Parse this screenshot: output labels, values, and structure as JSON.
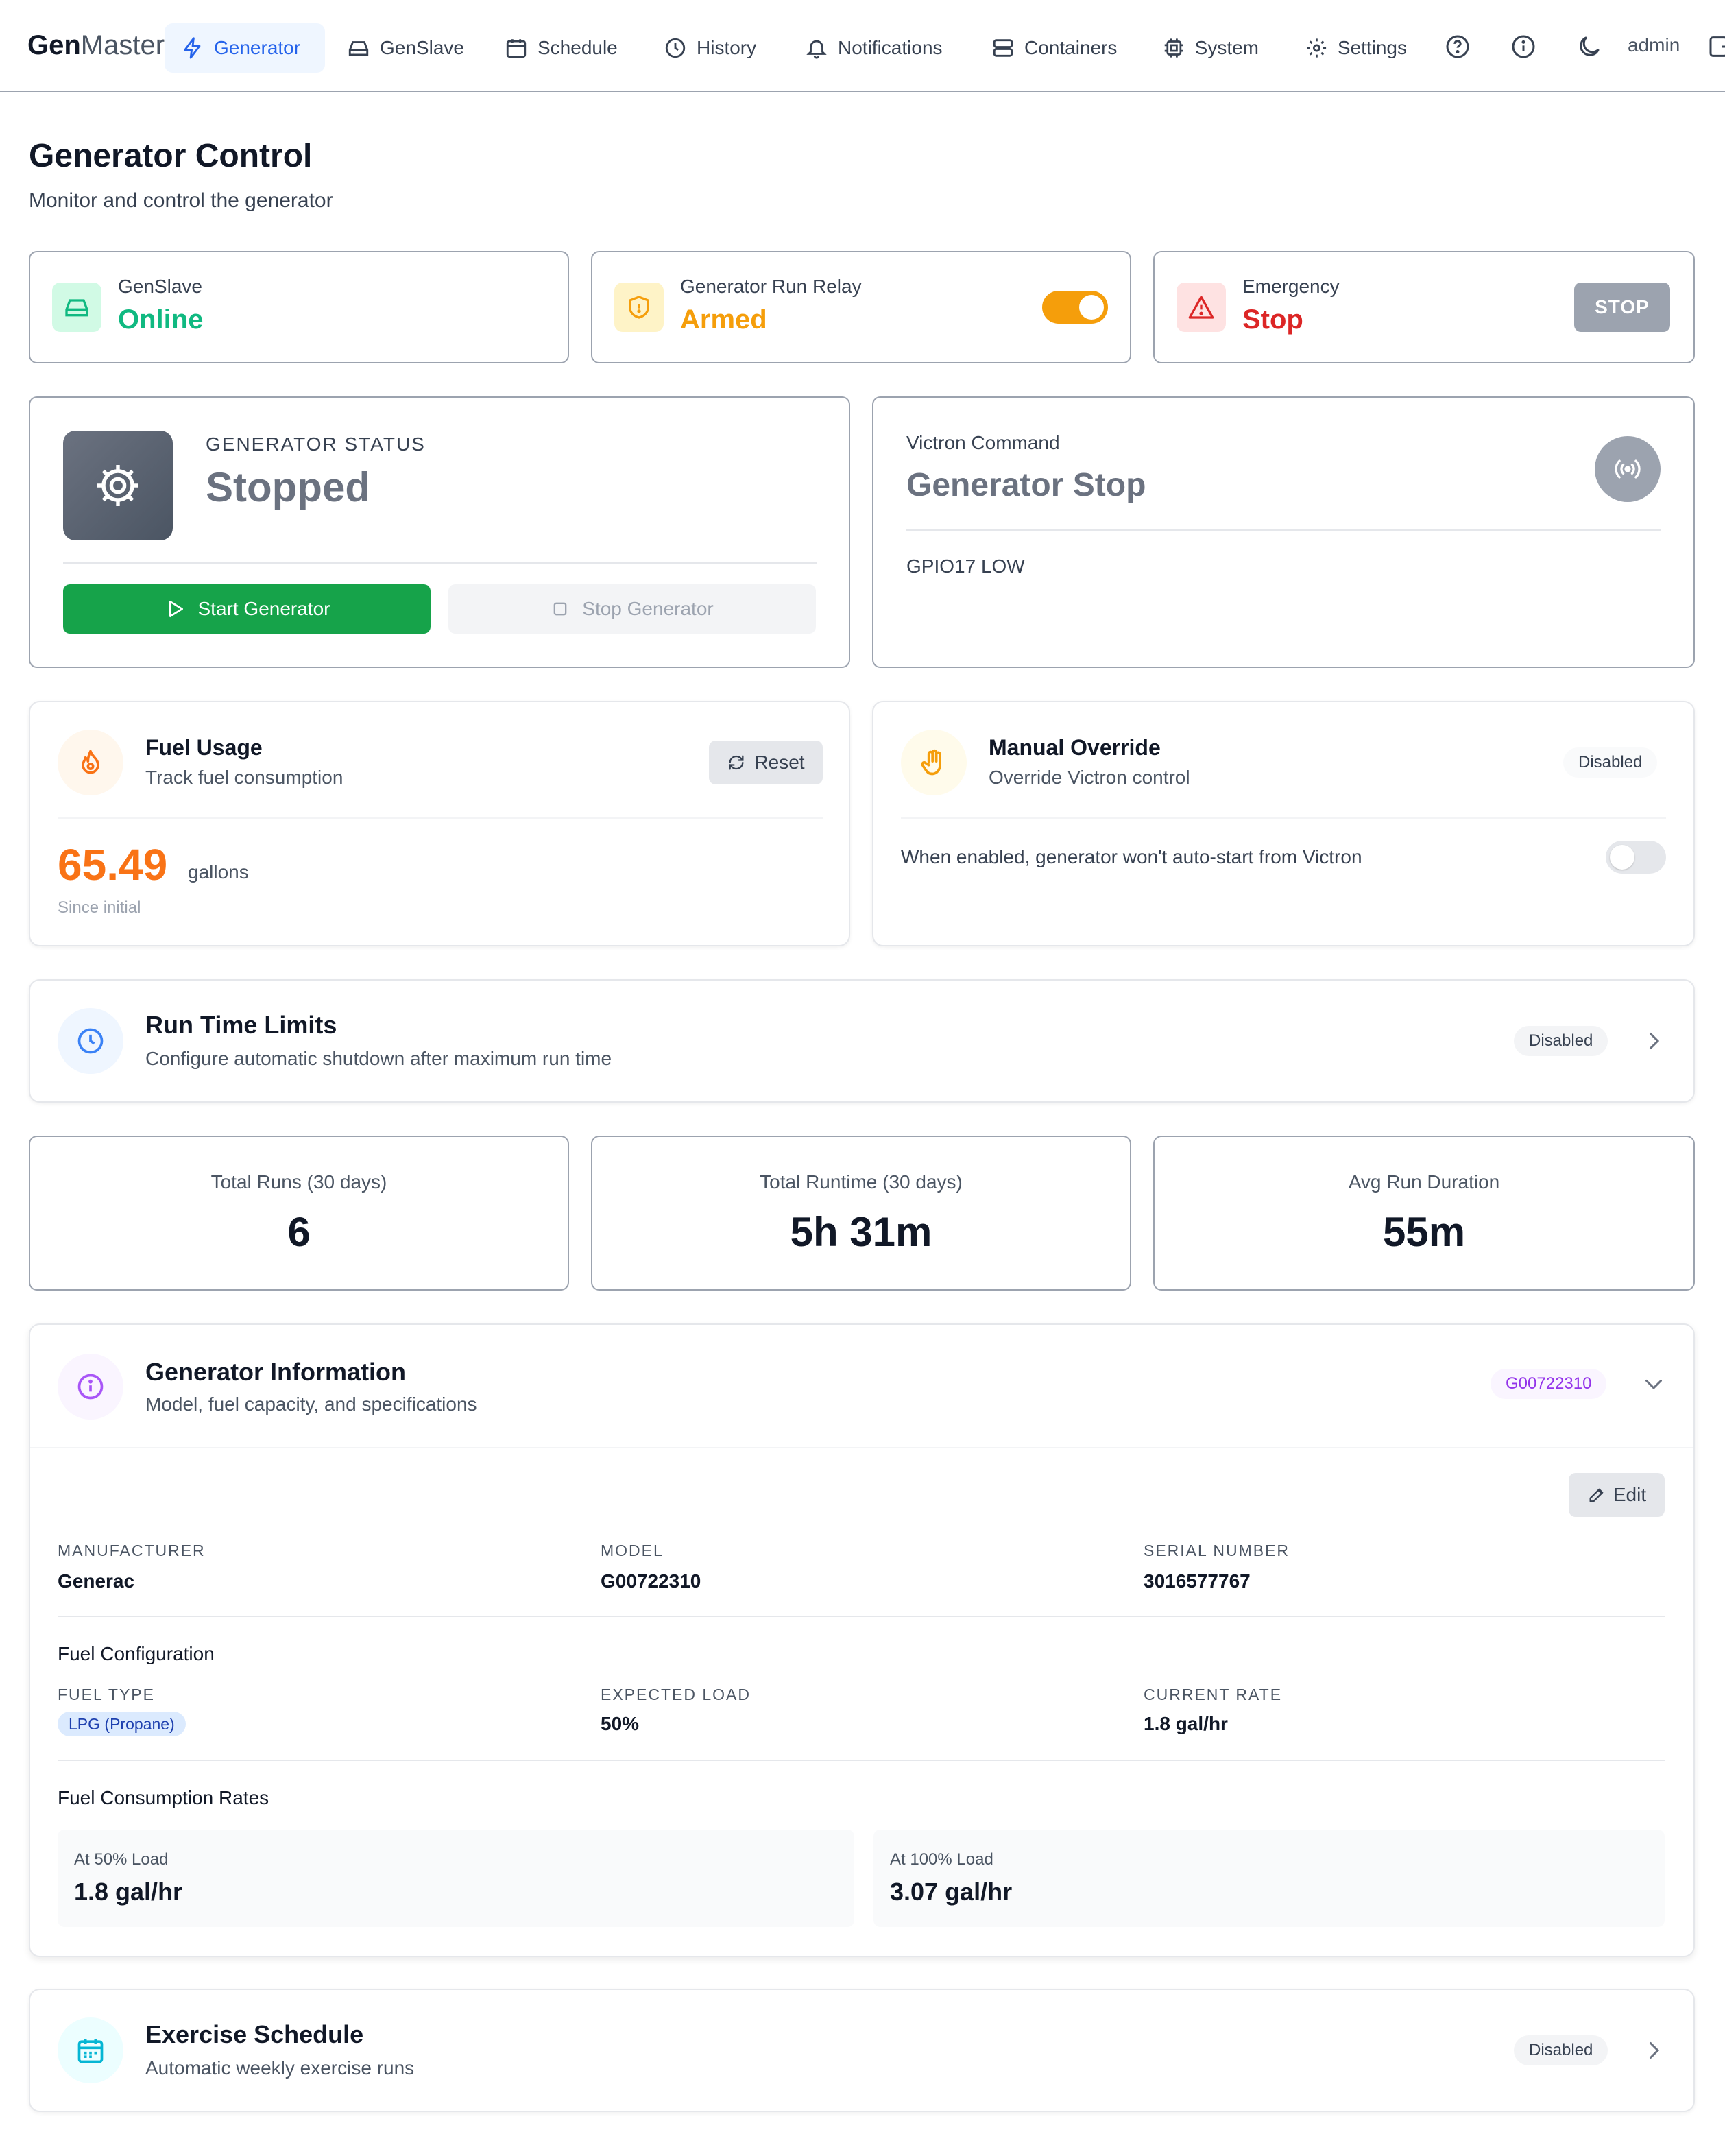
{
  "nav": {
    "brand_bold": "Gen",
    "brand_light": "Master",
    "items": [
      {
        "label": "Generator",
        "icon": "bolt-icon",
        "active": true
      },
      {
        "label": "GenSlave",
        "icon": "hard-drive-icon"
      },
      {
        "label": "Schedule",
        "icon": "calendar-icon"
      },
      {
        "label": "History",
        "icon": "clock-icon"
      },
      {
        "label": "Notifications",
        "icon": "bell-icon"
      },
      {
        "label": "Containers",
        "icon": "server-icon"
      },
      {
        "label": "System",
        "icon": "cpu-icon"
      },
      {
        "label": "Settings",
        "icon": "gear-icon"
      }
    ],
    "user": "admin"
  },
  "page": {
    "title": "Generator Control",
    "subtitle": "Monitor and control the generator"
  },
  "status_cards": {
    "genslave": {
      "label": "GenSlave",
      "value": "Online"
    },
    "relay": {
      "label": "Generator Run Relay",
      "value": "Armed",
      "toggle_on": true
    },
    "emergency": {
      "label": "Emergency",
      "value": "Stop",
      "button": "STOP"
    }
  },
  "generator_status": {
    "label": "GENERATOR STATUS",
    "value": "Stopped",
    "start_button": "Start Generator",
    "stop_button": "Stop Generator"
  },
  "victron": {
    "label": "Victron Command",
    "value": "Generator Stop",
    "gpio": "GPIO17 LOW"
  },
  "fuel": {
    "title": "Fuel Usage",
    "subtitle": "Track fuel consumption",
    "reset": "Reset",
    "amount": "65.49",
    "unit": "gallons",
    "note": "Since initial"
  },
  "override": {
    "title": "Manual Override",
    "subtitle": "Override Victron control",
    "badge": "Disabled",
    "description": "When enabled, generator won't auto-start from Victron",
    "toggle_on": false
  },
  "runtime_limits": {
    "title": "Run Time Limits",
    "subtitle": "Configure automatic shutdown after maximum run time",
    "badge": "Disabled"
  },
  "stats": [
    {
      "label": "Total Runs (30 days)",
      "value": "6"
    },
    {
      "label": "Total Runtime (30 days)",
      "value": "5h 31m"
    },
    {
      "label": "Avg Run Duration",
      "value": "55m"
    }
  ],
  "gen_info": {
    "title": "Generator Information",
    "subtitle": "Model, fuel capacity, and specifications",
    "badge": "G00722310",
    "edit": "Edit",
    "fields": [
      {
        "label": "MANUFACTURER",
        "value": "Generac"
      },
      {
        "label": "MODEL",
        "value": "G00722310"
      },
      {
        "label": "SERIAL NUMBER",
        "value": "3016577767"
      }
    ],
    "fuel_config_title": "Fuel Configuration",
    "fuel_fields": [
      {
        "label": "FUEL TYPE",
        "value": "LPG (Propane)"
      },
      {
        "label": "EXPECTED LOAD",
        "value": "50%"
      },
      {
        "label": "CURRENT RATE",
        "value": "1.8 gal/hr"
      }
    ],
    "rates_title": "Fuel Consumption Rates",
    "rates": [
      {
        "label": "At 50% Load",
        "value": "1.8 gal/hr"
      },
      {
        "label": "At 100% Load",
        "value": "3.07 gal/hr"
      }
    ]
  },
  "exercise": {
    "title": "Exercise Schedule",
    "subtitle": "Automatic weekly exercise runs",
    "badge": "Disabled"
  },
  "colors": {
    "primary": "#2563eb",
    "success": "#16a34a",
    "online": "#10b981",
    "armed": "#f59e0b",
    "danger": "#dc2626",
    "fuel": "#f97316"
  }
}
